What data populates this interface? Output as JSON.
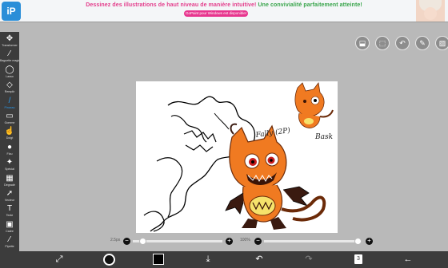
{
  "banner": {
    "logo_text": "iP",
    "headline_part1": "Dessinez des illustrations de haut niveau de manière intuitive!",
    "headline_part2": "Une convivialité parfaitement atteinte!",
    "subline": "GoPaint pour Windows est disponible!"
  },
  "toolbar": {
    "items": [
      {
        "icon": "move-icon",
        "glyph": "✥",
        "label": "Transformer"
      },
      {
        "icon": "magic-wand-icon",
        "glyph": "⁄",
        "label": "Baguette magique"
      },
      {
        "icon": "lasso-icon",
        "glyph": "◯",
        "label": "Lasso"
      },
      {
        "icon": "fill-icon",
        "glyph": "◇",
        "label": "Remplir"
      },
      {
        "icon": "brush-icon",
        "glyph": "/",
        "label": "Pinceau"
      },
      {
        "icon": "eraser-icon",
        "glyph": "▭",
        "label": "Gomme"
      },
      {
        "icon": "smudge-icon",
        "glyph": "☝",
        "label": "Doigt"
      },
      {
        "icon": "blur-icon",
        "glyph": "●",
        "label": "Flou"
      },
      {
        "icon": "special-brush-icon",
        "glyph": "✦",
        "label": "Spécial"
      },
      {
        "icon": "gradient-icon",
        "glyph": "▦",
        "label": "Dégradé"
      },
      {
        "icon": "select-icon",
        "glyph": "➚",
        "label": "Vecteur"
      },
      {
        "icon": "text-icon",
        "glyph": "T",
        "label": "Texte"
      },
      {
        "icon": "frame-divider-icon",
        "glyph": "▣",
        "label": "Cadre"
      },
      {
        "icon": "eyedropper-icon",
        "glyph": "⁄",
        "label": "Pipette"
      }
    ],
    "active_index": 4
  },
  "top_buttons": [
    {
      "icon": "layer-move-icon",
      "glyph": "⬓"
    },
    {
      "icon": "selection-icon",
      "glyph": "⬚"
    },
    {
      "icon": "crop-rotate-icon",
      "glyph": "↶"
    },
    {
      "icon": "pencil-icon",
      "glyph": "✎"
    },
    {
      "icon": "image-icon",
      "glyph": "▨"
    }
  ],
  "canvas": {
    "handwritten_name": "Fally (2P)",
    "handwritten_side": "Bask"
  },
  "sliders": {
    "size_label": "2.5px",
    "size_value_fraction": 0.02,
    "opacity_label": "100%",
    "opacity_value_fraction": 1.0
  },
  "bottombar": {
    "items": [
      {
        "icon": "transform-tool-icon",
        "glyph": "⤢"
      },
      {
        "icon": "download-icon",
        "glyph": "⤓"
      },
      {
        "icon": "undo-icon",
        "glyph": "↶"
      },
      {
        "icon": "redo-icon",
        "glyph": "↷"
      },
      {
        "icon": "back-arrow-icon",
        "glyph": "←"
      }
    ],
    "layer_count": "3",
    "primary_color": "#111111",
    "secondary_color": "#000000"
  }
}
